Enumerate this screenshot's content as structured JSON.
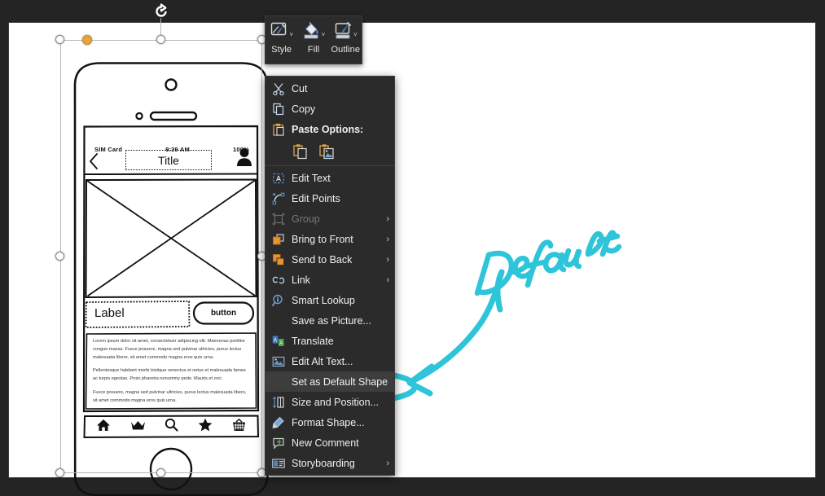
{
  "colors": {
    "app_background": "#242424",
    "canvas": "#ffffff",
    "menu_background": "#2b2b2b",
    "menu_text": "#f0f0f0",
    "menu_disabled_text": "#777777",
    "highlight_row": "#3d3d3d",
    "ink_cyan": "#2ec4d9",
    "adjust_handle_orange": "#e8a33d",
    "accent_blue": "#4a86c8",
    "accent_orange": "#e8a33d"
  },
  "mini_toolbar": {
    "items": [
      {
        "label": "Style",
        "icon": "shape-style-icon",
        "caret": "˅"
      },
      {
        "label": "Fill",
        "icon": "paint-bucket-icon",
        "caret": "˅"
      },
      {
        "label": "Outline",
        "icon": "shape-outline-icon",
        "caret": "˅"
      }
    ]
  },
  "context_menu": {
    "items": [
      {
        "label": "Cut",
        "icon": "scissors-icon",
        "state": "normal",
        "submenu": false,
        "accel_index": 2
      },
      {
        "label": "Copy",
        "icon": "copy-icon",
        "state": "normal",
        "submenu": false,
        "accel_index": 0
      },
      {
        "label": "Paste Options:",
        "icon": "paste-icon",
        "state": "header",
        "submenu": false
      },
      {
        "label": "Edit Text",
        "icon": "edit-text-icon",
        "state": "normal",
        "submenu": false
      },
      {
        "label": "Edit Points",
        "icon": "edit-points-icon",
        "state": "normal",
        "submenu": false
      },
      {
        "label": "Group",
        "icon": "group-icon",
        "state": "disabled",
        "submenu": true
      },
      {
        "label": "Bring to Front",
        "icon": "bring-to-front-icon",
        "state": "normal",
        "submenu": true
      },
      {
        "label": "Send to Back",
        "icon": "send-to-back-icon",
        "state": "normal",
        "submenu": true
      },
      {
        "label": "Link",
        "icon": "link-icon",
        "state": "normal",
        "submenu": true
      },
      {
        "label": "Smart Lookup",
        "icon": "smart-lookup-icon",
        "state": "normal",
        "submenu": false
      },
      {
        "label": "Save as Picture...",
        "icon": "none",
        "state": "normal",
        "submenu": false
      },
      {
        "label": "Translate",
        "icon": "translate-icon",
        "state": "normal",
        "submenu": false
      },
      {
        "label": "Edit Alt Text...",
        "icon": "alt-text-icon",
        "state": "normal",
        "submenu": false
      },
      {
        "label": "Set as Default Shape",
        "icon": "none",
        "state": "highlighted",
        "submenu": false
      },
      {
        "label": "Size and Position...",
        "icon": "size-position-icon",
        "state": "normal",
        "submenu": false
      },
      {
        "label": "Format Shape...",
        "icon": "format-shape-icon",
        "state": "normal",
        "submenu": false
      },
      {
        "label": "New Comment",
        "icon": "comment-icon",
        "state": "normal",
        "submenu": false
      },
      {
        "label": "Storyboarding",
        "icon": "storyboarding-icon",
        "state": "normal",
        "submenu": true
      }
    ],
    "paste_options": [
      {
        "name": "paste-keep-source-formatting-icon"
      },
      {
        "name": "paste-picture-icon"
      }
    ],
    "submenu_arrow": "›"
  },
  "annotation": {
    "text": "Default",
    "color": "#2ec4d9",
    "arrow_target": "Set as Default Shape"
  },
  "phone_mockup": {
    "status_bar": {
      "carrier": "SIM Card",
      "time": "9:39 AM",
      "battery": "100%"
    },
    "nav_bar": {
      "back_icon": "chevron-left-icon",
      "title": "Title",
      "avatar_icon": "person-avatar-icon"
    },
    "image_placeholder": {
      "icon": "image-placeholder-x-icon"
    },
    "label_field": {
      "text": "Label"
    },
    "primary_button": {
      "text": "button"
    },
    "body_paragraphs": [
      "Lorem ipsum dolor sit amet, consectetuer adipiscing elit. Maecenas porttitor congue massa. Fusce posuere, magna sed pulvinar ultricies, purus lectus malesuada libero, sit amet commodo magna eros quis urna.",
      "Pellentesque habitant morbi tristique senectus et netus et malesuada fames ac turpis egestas. Proin pharetra nonummy pede. Mauris et orci.",
      "Fusce posuere, magna sed pulvinar ultricies, purus lectus malesuada libero, sit amet commodo magna eros quis urna."
    ],
    "tab_bar": [
      {
        "icon": "home-icon"
      },
      {
        "icon": "crown-icon"
      },
      {
        "icon": "search-icon"
      },
      {
        "icon": "star-icon"
      },
      {
        "icon": "basket-icon"
      }
    ],
    "home_button": {
      "icon": "home-button-circle"
    }
  },
  "selection": {
    "rotate_handle": "rotate-handle-icon",
    "handle_count": 8,
    "adjustment_handle": "corner-radius-adjust-handle"
  }
}
